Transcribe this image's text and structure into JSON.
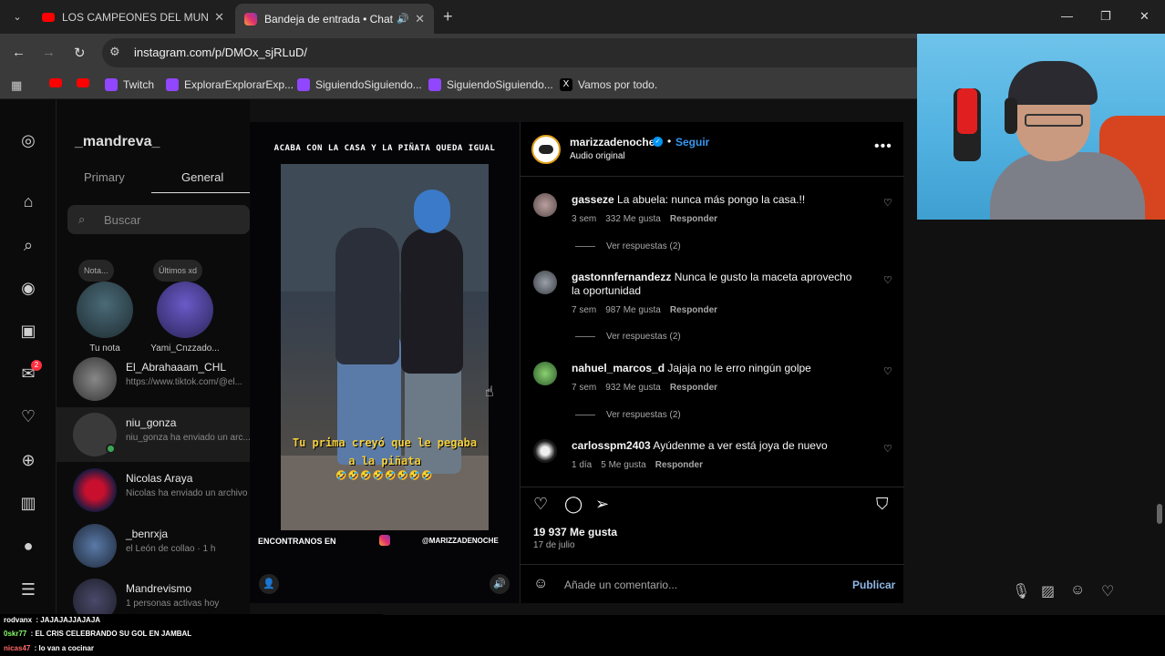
{
  "browser": {
    "tabs": [
      {
        "title": "LOS CAMPEONES DEL MUNDO",
        "favicon": "youtube-icon",
        "active": false
      },
      {
        "title": "Bandeja de entrada • Chats",
        "favicon": "instagram-icon",
        "active": true
      }
    ],
    "url": "instagram.com/p/DMOx_sjRLuD/",
    "bookmarks": [
      {
        "label": "",
        "icon": "youtube-icon"
      },
      {
        "label": "",
        "icon": "youtube-icon"
      },
      {
        "label": "Twitch",
        "icon": "twitch-icon"
      },
      {
        "label": "ExplorarExplorarExp...",
        "icon": "twitch-icon"
      },
      {
        "label": "SiguiendoSiguiendo...",
        "icon": "twitch-icon"
      },
      {
        "label": "SiguiendoSiguiendo...",
        "icon": "twitch-icon"
      },
      {
        "label": "Vamos por todo.",
        "icon": "x-icon"
      }
    ]
  },
  "inbox": {
    "username": "_mandreva_",
    "tabs": [
      "Primary",
      "General"
    ],
    "search_placeholder": "Buscar",
    "notes": [
      {
        "bubble": "Nota...",
        "name": "Tu nota"
      },
      {
        "bubble": "Últimos xd",
        "name": "Yami_Cnzzado..."
      }
    ],
    "chats": [
      {
        "name": "El_Abrahaaam_CHL",
        "preview": "https://www.tiktok.com/@el..."
      },
      {
        "name": "niu_gonza",
        "preview": "niu_gonza ha enviado un arc..."
      },
      {
        "name": "Nicolas Araya",
        "preview": "Nicolas ha enviado un archivo"
      },
      {
        "name": "_benrxja",
        "preview": "el León de collao · 1 h"
      },
      {
        "name": "Mandrevismo",
        "preview": "1 personas activas hoy"
      }
    ],
    "nav_badges": {
      "messages": "2"
    }
  },
  "post": {
    "author": "marizzadenoche",
    "follow_label": "Seguir",
    "audio_label": "Audio original",
    "video": {
      "caption": "ACABA CON LA CASA Y LA PIÑATA QUEDA IGUAL",
      "overlay_text": "Tu prima creyó que le pegaba a la piñata",
      "emoji_row": "🤣🤣🤣🤣🤣🤣🤣🤣",
      "footer_left": "ENCONTRANOS EN",
      "footer_right": "@MARIZZADENOCHE"
    },
    "comments": [
      {
        "user": "gasseze",
        "text": "La abuela: nunca más pongo la casa.!!",
        "age": "3 sem",
        "likes": "332 Me gusta",
        "reply": "Responder",
        "replies": "Ver respuestas (2)"
      },
      {
        "user": "gastonnfernandezz",
        "text": "Nunca le gusto la maceta aprovecho la oportunidad",
        "age": "7 sem",
        "likes": "987 Me gusta",
        "reply": "Responder",
        "replies": "Ver respuestas (2)"
      },
      {
        "user": "nahuel_marcos_d",
        "text": "Jajaja no le erro ningún golpe",
        "age": "7 sem",
        "likes": "932 Me gusta",
        "reply": "Responder",
        "replies": "Ver respuestas (2)"
      },
      {
        "user": "carlosspm2403",
        "text": "Ayúdenme a ver está joya de nuevo",
        "age": "1 día",
        "likes": "5 Me gusta",
        "reply": "Responder",
        "replies": ""
      }
    ],
    "likes_total": "19 937 Me gusta",
    "date": "17 de julio",
    "comment_placeholder": "Añade un comentario...",
    "publish_label": "Publicar"
  },
  "stream_chat": [
    {
      "user": "rodvanx",
      "message": "JAJAJAJJAJAJA",
      "color": "#ffffff"
    },
    {
      "user": "0skr77",
      "message": "EL CRIS CELEBRANDO SU GOL EN JAMBAL",
      "color": "#8aff6a"
    },
    {
      "user": "nicas47",
      "message": "lo van a cocinar",
      "color": "#ff6a6a"
    }
  ],
  "colors": {
    "accent": "#0095f6",
    "link": "#3897f0",
    "badge": "#ff3040"
  }
}
